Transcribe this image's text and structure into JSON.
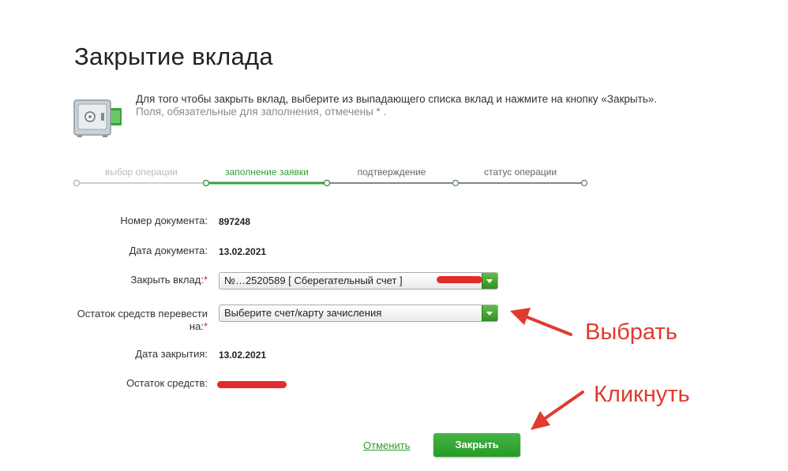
{
  "page": {
    "title": "Закрытие вклада",
    "intro_line1": "Для того чтобы закрыть вклад, выберите из выпадающего списка вклад и нажмите на кнопку «Закрыть».",
    "intro_line2": "Поля, обязательные для заполнения, отмечены * ."
  },
  "steps": [
    {
      "label": "выбор операции",
      "state": "done"
    },
    {
      "label": "заполнение заявки",
      "state": "active"
    },
    {
      "label": "подтверждение",
      "state": "pending"
    },
    {
      "label": "статус операции",
      "state": "pending"
    }
  ],
  "form": {
    "doc_number_label": "Номер документа:",
    "doc_number_value": "897248",
    "doc_date_label": "Дата документа:",
    "doc_date_value": "13.02.2021",
    "close_deposit_label": "Закрыть вклад:",
    "close_deposit_value": "№…2520589  [ Сберегательный счет ]",
    "transfer_label_line1": "Остаток средств перевести",
    "transfer_label_line2": "на:",
    "transfer_placeholder": "Выберите счет/карту зачисления",
    "close_date_label": "Дата закрытия:",
    "close_date_value": "13.02.2021",
    "balance_label": "Остаток средств:",
    "required_mark": "*"
  },
  "actions": {
    "cancel_label": "Отменить",
    "close_label": "Закрыть"
  },
  "annotations": {
    "select_hint": "Выбрать",
    "click_hint": "Кликнуть"
  },
  "colors": {
    "accent_green": "#2f9b2f",
    "annotation_red": "#e03a2e"
  }
}
